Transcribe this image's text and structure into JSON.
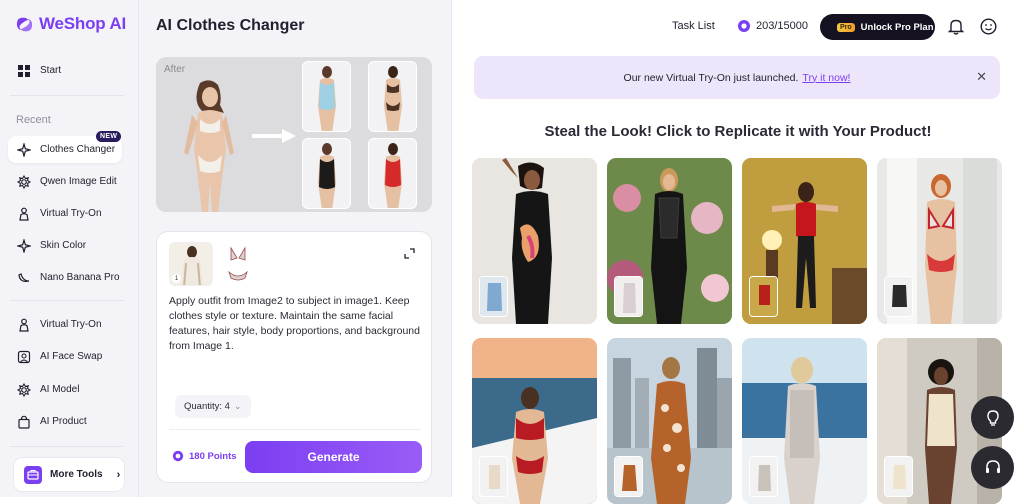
{
  "brand": {
    "name": "WeShop AI",
    "color": "#7b3ff2"
  },
  "sidebar": {
    "start_label": "Start",
    "recent_label": "Recent",
    "new_badge": "NEW",
    "recent_items": [
      {
        "label": "Clothes Changer",
        "icon": "sparkle-icon"
      },
      {
        "label": "Qwen Image Edit",
        "icon": "gear-flower-icon"
      },
      {
        "label": "Virtual Try-On",
        "icon": "person-icon"
      },
      {
        "label": "Skin Color",
        "icon": "sparkle-icon"
      },
      {
        "label": "Nano Banana Pro",
        "icon": "banana-icon"
      }
    ],
    "tool_items": [
      {
        "label": "Virtual Try-On",
        "icon": "person-icon"
      },
      {
        "label": "AI Face Swap",
        "icon": "face-swap-icon"
      },
      {
        "label": "AI Model",
        "icon": "gear-flower-icon"
      },
      {
        "label": "AI Product",
        "icon": "bag-icon"
      }
    ],
    "more_tools_label": "More Tools"
  },
  "panel": {
    "title": "AI Clothes Changer",
    "preview_label": "After",
    "prompt_text": "Apply outfit from Image2 to subject in image1. Keep clothes style or texture. Maintain the same facial features, hair style, body proportions, and background from Image 1.",
    "ref_badge": "1",
    "quantity_label": "Quantity: 4",
    "points_label": "180 Points",
    "generate_label": "Generate"
  },
  "header": {
    "task_list": "Task List",
    "credits": "203/15000",
    "pro_tag": "Pro",
    "unlock_label": "Unlock Pro Plan"
  },
  "banner": {
    "text": "Our new Virtual Try-On just launched.",
    "link": "Try it now!",
    "close": "✕"
  },
  "gallery": {
    "title": "Steal the Look! Click to Replicate it with Your Product!"
  }
}
